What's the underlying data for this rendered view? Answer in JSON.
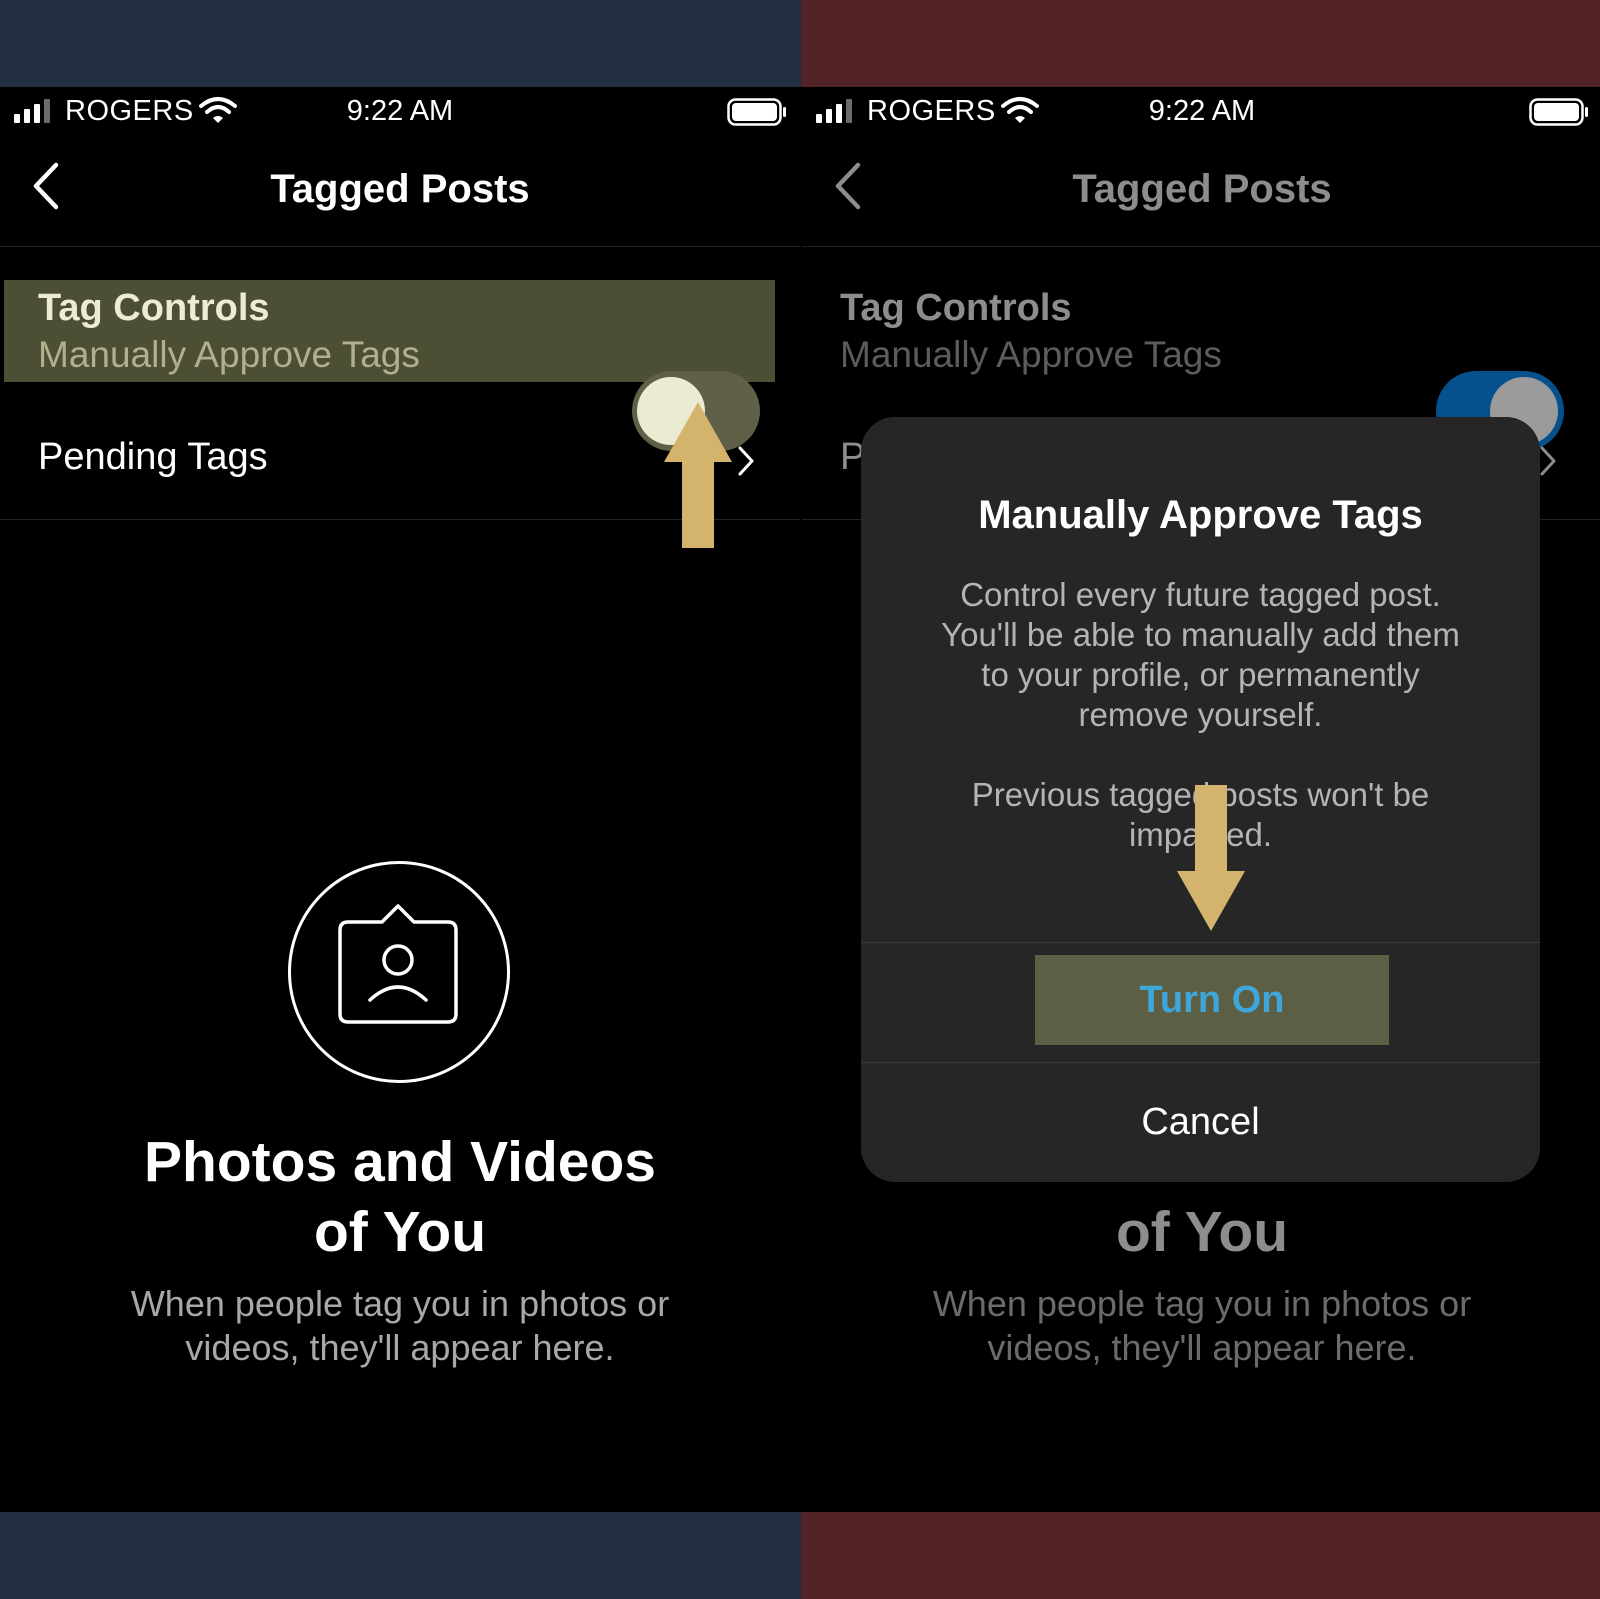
{
  "colors": {
    "band_left": "#222e41",
    "band_right": "#532427",
    "highlight": "#4d4f35",
    "toggle_on": "#06518d",
    "turn_on_text": "#3fa6d9",
    "annotation_arrow": "#d4b46d"
  },
  "left_screen": {
    "status_bar": {
      "carrier": "ROGERS",
      "time": "9:22 AM",
      "icons": [
        "signal-icon",
        "wifi-icon",
        "battery-icon"
      ]
    },
    "nav": {
      "title": "Tagged Posts",
      "back_icon": "chevron-left-icon"
    },
    "tag_controls": {
      "title": "Tag Controls",
      "subtitle": "Manually Approve Tags",
      "toggle_state": "off"
    },
    "pending_tags": {
      "label": "Pending Tags",
      "icon": "chevron-right-icon"
    },
    "empty_state": {
      "icon": "tagged-person-icon",
      "title_line1": "Photos and Videos",
      "title_line2": "of You",
      "desc_line1": "When people tag you in photos or",
      "desc_line2": "videos, they'll appear here."
    }
  },
  "right_screen": {
    "status_bar": {
      "carrier": "ROGERS",
      "time": "9:22 AM"
    },
    "nav": {
      "title": "Tagged Posts"
    },
    "tag_controls": {
      "title": "Tag Controls",
      "subtitle": "Manually Approve Tags",
      "toggle_state": "on"
    },
    "pending_tags": {
      "label": "P"
    },
    "empty_state": {
      "title_line2": "of You",
      "desc_line1": "When people tag you in photos or",
      "desc_line2": "videos, they'll appear here."
    },
    "dialog": {
      "title": "Manually Approve Tags",
      "body_line1": "Control every future tagged post.",
      "body_line2": "You'll be able to manually add them",
      "body_line3": "to your profile, or permanently",
      "body_line4": "remove yourself.",
      "note_line1": "Previous tagged posts won't be",
      "note_line2": "impacted.",
      "primary_button": "Turn On",
      "secondary_button": "Cancel"
    }
  }
}
